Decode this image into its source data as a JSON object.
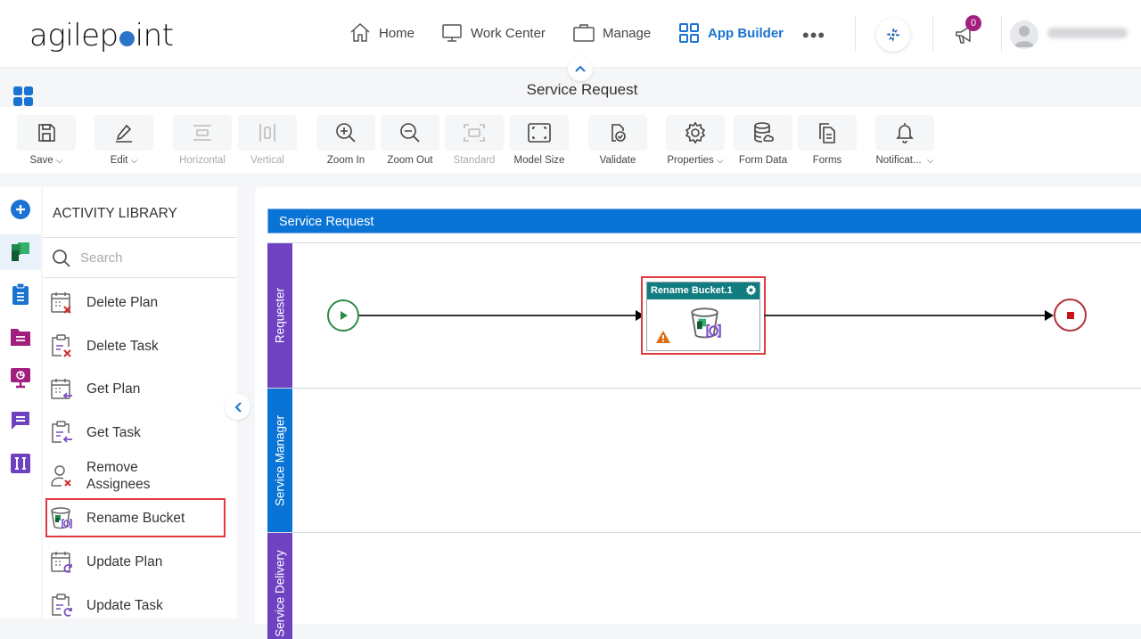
{
  "brand": {
    "logo_pre": "agilep",
    "logo_post": "int",
    "accent": "#1a73d2"
  },
  "nav": {
    "items": [
      {
        "label": "Home",
        "icon": "home-icon"
      },
      {
        "label": "Work Center",
        "icon": "monitor-icon"
      },
      {
        "label": "Manage",
        "icon": "briefcase-icon"
      },
      {
        "label": "App Builder",
        "icon": "grid-icon",
        "active": true
      }
    ],
    "more": "•••",
    "notifications_count": "0"
  },
  "page": {
    "title": "Service Request"
  },
  "toolbar": [
    {
      "label": "Save",
      "dropdown": true,
      "icon": "save-icon"
    },
    {
      "label": "Edit",
      "dropdown": true,
      "icon": "pencil-icon"
    },
    {
      "label": "Horizontal",
      "disabled": true,
      "icon": "horizontal-icon"
    },
    {
      "label": "Vertical",
      "disabled": true,
      "icon": "vertical-icon"
    },
    {
      "label": "Zoom In",
      "icon": "zoom-in-icon"
    },
    {
      "label": "Zoom Out",
      "icon": "zoom-out-icon"
    },
    {
      "label": "Standard",
      "disabled": true,
      "icon": "standard-icon"
    },
    {
      "label": "Model Size",
      "icon": "model-size-icon"
    },
    {
      "label": "Validate",
      "icon": "validate-icon"
    },
    {
      "label": "Properties",
      "dropdown": true,
      "icon": "gear-icon"
    },
    {
      "label": "Form Data",
      "icon": "database-icon"
    },
    {
      "label": "Forms",
      "icon": "forms-icon"
    },
    {
      "label": "Notificat...",
      "dropdown": true,
      "icon": "bell-icon"
    }
  ],
  "library": {
    "title": "ACTIVITY LIBRARY",
    "search_placeholder": "Search",
    "items": [
      {
        "label": "Delete Plan"
      },
      {
        "label": "Delete Task"
      },
      {
        "label": "Get Plan"
      },
      {
        "label": "Get Task"
      },
      {
        "label": "Remove Assignees"
      },
      {
        "label": "Rename Bucket",
        "highlighted": true
      },
      {
        "label": "Update Plan"
      },
      {
        "label": "Update Task"
      }
    ]
  },
  "process": {
    "pool": "Service Request",
    "lanes": [
      {
        "label": "Requester",
        "color": "#6f42c1"
      },
      {
        "label": "Service Manager",
        "color": "#0a74d6"
      },
      {
        "label": "Service Delivery",
        "color": "#6f42c1"
      }
    ],
    "activity": {
      "label": "Rename Bucket.1",
      "warning": true
    }
  }
}
